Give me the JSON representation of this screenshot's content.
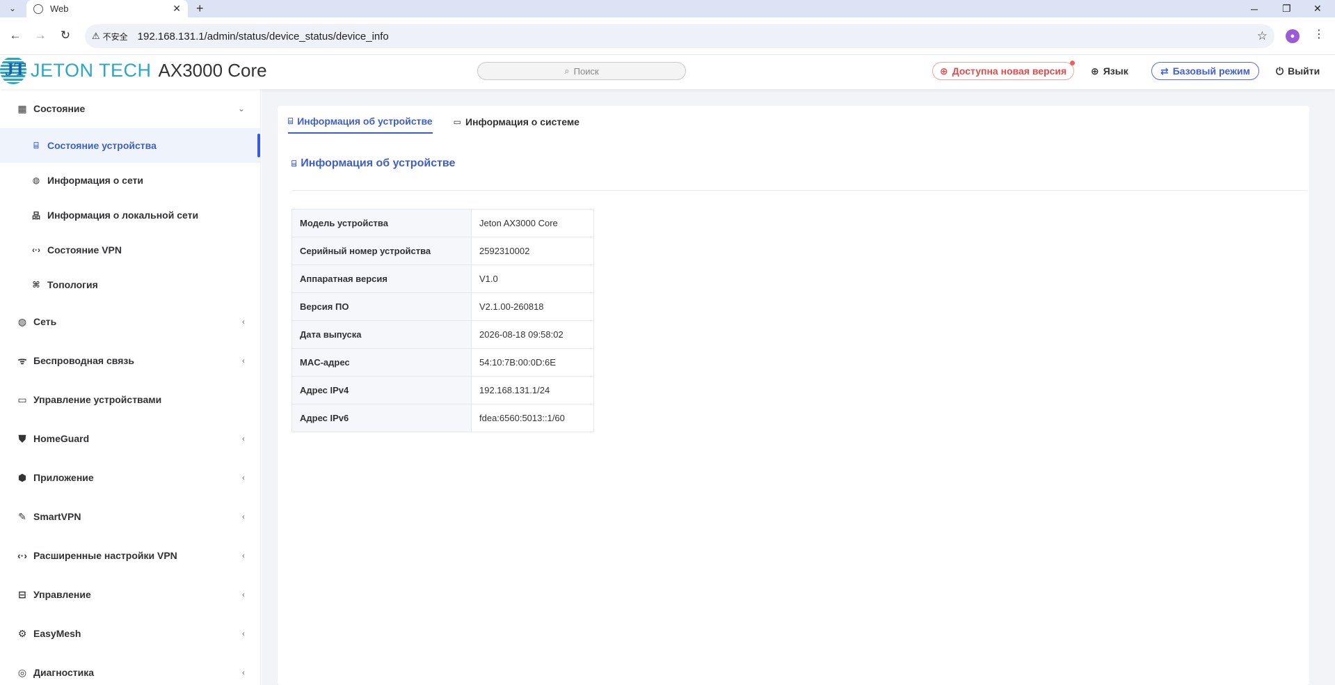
{
  "browser": {
    "tab_title": "Web",
    "new_tab": "+",
    "insecure_label": "不安全",
    "url": "192.168.131.1/admin/status/device_status/device_info"
  },
  "header": {
    "logo_text": "JETON TECH",
    "model": "AX3000 Core",
    "search_placeholder": "Поиск",
    "new_version": "Доступна новая версия",
    "language": "Язык",
    "mode": "Базовый режим",
    "logout": "Выйти"
  },
  "sidebar": {
    "status_group": "Состояние",
    "status_items": [
      {
        "label": "Состояние устройства",
        "icon": "router-icon"
      },
      {
        "label": "Информация о сети",
        "icon": "globe-icon"
      },
      {
        "label": "Информация о локальной сети",
        "icon": "network-icon"
      },
      {
        "label": "Состояние VPN",
        "icon": "vpn-icon"
      },
      {
        "label": "Топология",
        "icon": "topology-icon"
      }
    ],
    "groups": [
      {
        "label": "Сеть",
        "icon": "globe-icon"
      },
      {
        "label": "Беспроводная связь",
        "icon": "wifi-icon"
      },
      {
        "label": "Управление устройствами",
        "icon": "devices-icon"
      },
      {
        "label": "HomeGuard",
        "icon": "shield-icon"
      },
      {
        "label": "Приложение",
        "icon": "app-icon"
      },
      {
        "label": "SmartVPN",
        "icon": "smartvpn-icon"
      },
      {
        "label": "Расширенные настройки VPN",
        "icon": "vpn-icon"
      },
      {
        "label": "Управление",
        "icon": "toolbox-icon"
      },
      {
        "label": "EasyMesh",
        "icon": "mesh-icon"
      },
      {
        "label": "Диагностика",
        "icon": "diagnostics-icon"
      }
    ]
  },
  "main": {
    "tabs": [
      "Информация об устройстве",
      "Информация о системе"
    ],
    "section_title": "Информация об устройстве",
    "rows": [
      {
        "k": "Модель устройства",
        "v": "Jeton AX3000 Core"
      },
      {
        "k": "Серийный номер устройства",
        "v": "2592310002"
      },
      {
        "k": "Аппаратная версия",
        "v": "V1.0"
      },
      {
        "k": "Версия ПО",
        "v": "V2.1.00-260818"
      },
      {
        "k": "Дата выпуска",
        "v": "2026-08-18 09:58:02"
      },
      {
        "k": "MAC-адрес",
        "v": "54:10:7B:00:0D:6E"
      },
      {
        "k": "Адрес IPv4",
        "v": "192.168.131.1/24"
      },
      {
        "k": "Адрес IPv6",
        "v": "fdea:6560:5013::1/60"
      }
    ]
  },
  "colors": {
    "accent": "#3a5bd9",
    "alert": "#e24c4c",
    "logo": "#2aa8c9"
  }
}
